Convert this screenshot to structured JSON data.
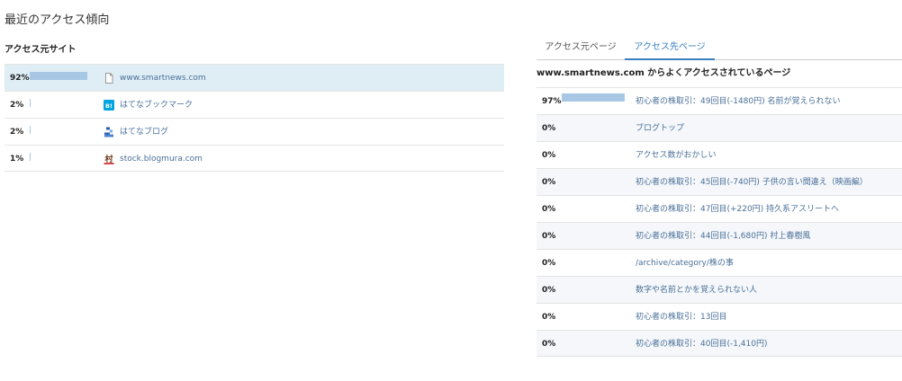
{
  "page": {
    "title": "最近のアクセス傾向"
  },
  "left": {
    "heading": "アクセス元サイト",
    "rows": [
      {
        "pct": "92%",
        "level": 0.92,
        "label": "www.smartnews.com",
        "icon": "document-icon",
        "selected": true
      },
      {
        "pct": "2%",
        "level": 0.02,
        "label": "はてなブックマーク",
        "icon": "hatena-bookmark-icon",
        "selected": false
      },
      {
        "pct": "2%",
        "level": 0.02,
        "label": "はてなブログ",
        "icon": "hatena-blog-icon",
        "selected": false
      },
      {
        "pct": "1%",
        "level": 0.01,
        "label": "stock.blogmura.com",
        "icon": "blogmura-icon",
        "selected": false
      }
    ]
  },
  "right": {
    "tabs": [
      {
        "label": "アクセス元ページ",
        "active": false
      },
      {
        "label": "アクセス先ページ",
        "active": true
      }
    ],
    "heading": "www.smartnews.com からよくアクセスされているページ",
    "rows": [
      {
        "pct": "97%",
        "level": 0.97,
        "label": "初心者の株取引：49回目(-1480円) 名前が覚えられない"
      },
      {
        "pct": "0%",
        "level": 0,
        "label": "ブログトップ"
      },
      {
        "pct": "0%",
        "level": 0,
        "label": "アクセス数がおかしい"
      },
      {
        "pct": "0%",
        "level": 0,
        "label": "初心者の株取引：45回目(-740円) 子供の言い間違え（映画編）"
      },
      {
        "pct": "0%",
        "level": 0,
        "label": "初心者の株取引：47回目(+220円) 持久系アスリートへ"
      },
      {
        "pct": "0%",
        "level": 0,
        "label": "初心者の株取引：44回目(-1,680円) 村上春樹風"
      },
      {
        "pct": "0%",
        "level": 0,
        "label": "/archive/category/株の事"
      },
      {
        "pct": "0%",
        "level": 0,
        "label": "数字や名前とかを覚えられない人"
      },
      {
        "pct": "0%",
        "level": 0,
        "label": "初心者の株取引：13回目"
      },
      {
        "pct": "0%",
        "level": 0,
        "label": "初心者の株取引：40回目(-1,410円)"
      }
    ]
  },
  "colors": {
    "bar": "#a7c7e4",
    "link": "#4a6f99",
    "tab_active": "#3a7fc0",
    "selected_row": "#dfedf5"
  },
  "icons": {
    "bookmark_text": "B!",
    "blogmura_text": "村"
  }
}
